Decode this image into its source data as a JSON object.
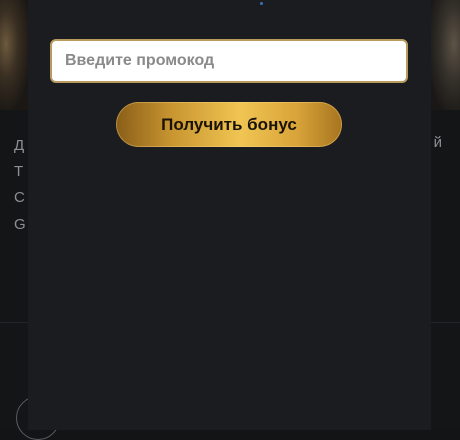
{
  "background": {
    "left_lines": [
      "Д",
      "Т",
      "С"
    ],
    "left_bold_line": "G",
    "right_line": "й"
  },
  "promo": {
    "input_placeholder": "Введите промокод",
    "input_value": "",
    "submit_label": "Получить бонус"
  },
  "colors": {
    "modal_bg": "#1b1c20",
    "page_bg": "#141517",
    "input_border": "#b99b5f",
    "button_gold": "#f0c552",
    "button_text": "#1a1206"
  }
}
